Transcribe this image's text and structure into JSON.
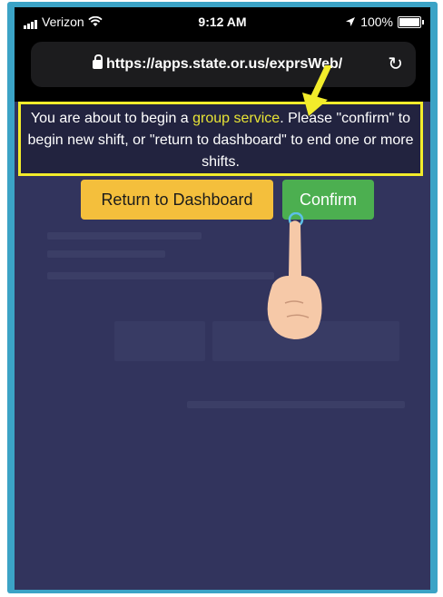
{
  "status_bar": {
    "carrier": "Verizon",
    "time": "9:12 AM",
    "battery": "100%"
  },
  "browser": {
    "url": "https://apps.state.or.us/exprsWeb/"
  },
  "notice": {
    "text_before": "You are about to begin a ",
    "highlight": "group service",
    "text_after": ". Please \"confirm\" to begin new shift, or \"return to dashboard\" to end one or more shifts."
  },
  "buttons": {
    "return_label": "Return to Dashboard",
    "confirm_label": "Confirm"
  },
  "colors": {
    "highlight_border": "#f2ec2b",
    "return_button": "#f4bf3c",
    "confirm_button": "#4caf50",
    "frame": "#3ba3c6"
  }
}
